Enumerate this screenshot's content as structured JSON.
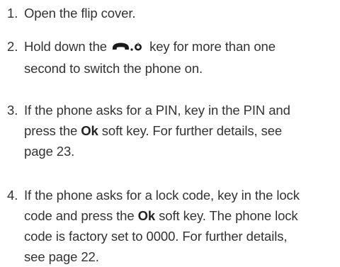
{
  "steps": [
    {
      "number": "1.",
      "text": "Open the flip cover."
    },
    {
      "number": "2.",
      "line1_before": "Hold down the",
      "icon": "end-call-power-key-icon",
      "line1_after": "key for more than one",
      "line2": "second to switch the phone on."
    },
    {
      "number": "3.",
      "line1": "If the phone asks for a PIN, key in the PIN and",
      "line2_before": "press the",
      "line2_key": "Ok",
      "line2_after": "soft key. For further details, see",
      "line3": "page 23."
    },
    {
      "number": "4.",
      "line1": "If the phone asks for a lock code, key in the lock",
      "line2_before": "code and press the",
      "line2_key": "Ok",
      "line2_after": "soft key. The phone lock",
      "line3": "code is factory set to 0000. For further details,",
      "line4": "see page 22."
    }
  ],
  "colors": {
    "text": "#333333",
    "icon": "#1a1a1a"
  }
}
